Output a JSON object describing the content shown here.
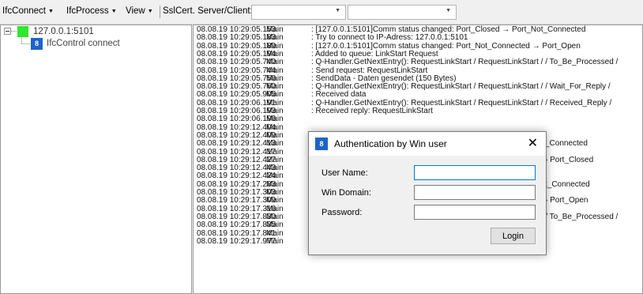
{
  "toolbar": {
    "menus": [
      {
        "label": "IfcConnect"
      },
      {
        "label": "IfcProcess"
      },
      {
        "label": "View"
      }
    ],
    "label": "SslCert. Server/Client:",
    "combo1_value": "",
    "combo2_value": ""
  },
  "tree": {
    "root_label": "127.0.0.1:5101",
    "child_label": "IfcControl connect",
    "child_icon": "8"
  },
  "log": {
    "rows": [
      {
        "ts": "08.08.19 10:29:05.153",
        "src": "Main",
        "msg": ": [127.0.0.1:5101]Comm status changed: Port_Closed → Port_Not_Connected"
      },
      {
        "ts": "08.08.19 10:29:05.183",
        "src": "Main",
        "msg": ": Try to connect to IP-Adress: 127.0.0.1:5101"
      },
      {
        "ts": "08.08.19 10:29:05.189",
        "src": "Main",
        "msg": ": [127.0.0.1:5101]Comm status changed: Port_Not_Connected → Port_Open"
      },
      {
        "ts": "08.08.19 10:29:05.194",
        "src": "Main",
        "msg": ": Added to queue: LinkStart Request"
      },
      {
        "ts": "08.08.19 10:29:05.740",
        "src": "Main",
        "msg": ": Q-Handler.GetNextEntry(): RequestLinkStart / RequestLinkStart / / To_Be_Processed /"
      },
      {
        "ts": "08.08.19 10:29:05.744",
        "src": "Main",
        "msg": ": Send request: RequestLinkStart"
      },
      {
        "ts": "08.08.19 10:29:05.756",
        "src": "Main",
        "msg": ": SendData - Daten gesendet (150 Bytes)"
      },
      {
        "ts": "08.08.19 10:29:05.760",
        "src": "Main",
        "msg": ": Q-Handler.GetNextEntry(): RequestLinkStart / RequestLinkStart / / Wait_For_Reply /"
      },
      {
        "ts": "08.08.19 10:29:05.905",
        "src": "Main",
        "msg": ": Received data"
      },
      {
        "ts": "08.08.19 10:29:06.191",
        "src": "Main",
        "msg": ": Q-Handler.GetNextEntry(): RequestLinkStart / RequestLinkStart / / Received_Reply /"
      },
      {
        "ts": "08.08.19 10:29:06.193",
        "src": "Main",
        "msg": ": Received reply: RequestLinkStart"
      },
      {
        "ts": "08.08.19 10:29:06.196",
        "src": "Main",
        "msg": ""
      },
      {
        "ts": "08.08.19 10:29:12.404",
        "src": "Main",
        "msg": ""
      },
      {
        "ts": "08.08.19 10:29:12.409",
        "src": "Main",
        "msg": ""
      },
      {
        "ts": "08.08.19 10:29:12.413",
        "src": "Main",
        "msg": ""
      },
      {
        "ts": "08.08.19 10:29:12.417",
        "src": "Main",
        "msg": ""
      },
      {
        "ts": "08.08.19 10:29:12.427",
        "src": "Main",
        "msg": ""
      },
      {
        "ts": "08.08.19 10:29:12.443",
        "src": "Main",
        "msg": ""
      },
      {
        "ts": "08.08.19 10:29:12.424",
        "src": "Main",
        "msg": ""
      },
      {
        "ts": "08.08.19 10:29:17.283",
        "src": "Main",
        "msg": ""
      },
      {
        "ts": "08.08.19 10:29:17.303",
        "src": "Main",
        "msg": ""
      },
      {
        "ts": "08.08.19 10:29:17.309",
        "src": "Main",
        "msg": ""
      },
      {
        "ts": "08.08.19 10:29:17.316",
        "src": "Main",
        "msg": ""
      },
      {
        "ts": "08.08.19 10:29:17.830",
        "src": "Main",
        "msg": ": Q-Handler.GetNextEntry(): RequestLinkStart / RequestLinkStart / / To_Be_Processed /"
      },
      {
        "ts": "08.08.19 10:29:17.835",
        "src": "Main",
        "msg": ": Send request: RequestLinkStart"
      },
      {
        "ts": "08.08.19 10:29:17.841",
        "src": "Main",
        "msg": ": SendData - Daten gesendet (150 Bytes)"
      },
      {
        "ts": "08.08.19 10:29:17.977",
        "src": "Main",
        "msg": ": Received data"
      }
    ],
    "peek": [
      {
        "row": 14,
        "text": "_Connected"
      },
      {
        "row": 16,
        "text": "› Port_Closed"
      },
      {
        "row": 19,
        "text": "t_Connected"
      },
      {
        "row": 21,
        "text": "› Port_Open"
      }
    ]
  },
  "dialog": {
    "title": "Authentication by Win user",
    "icon": "8",
    "close_glyph": "✕",
    "user_label": "User Name:",
    "domain_label": "Win Domain:",
    "password_label": "Password:",
    "user_value": "",
    "domain_value": "",
    "password_value": "",
    "login_label": "Login"
  },
  "colors": {
    "accent": "#0078d7",
    "node_green": "#2ee82e",
    "icon_blue": "#1e64c8"
  }
}
